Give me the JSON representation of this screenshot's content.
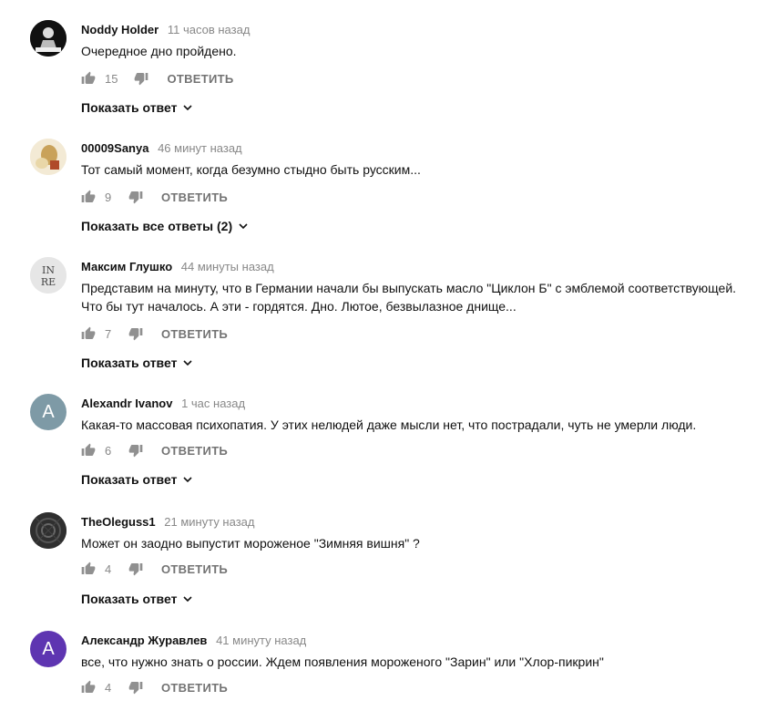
{
  "comments": [
    {
      "author": "Noddy Holder",
      "time": "11 часов назад",
      "text": "Очередное дно пройдено.",
      "likes": "15",
      "reply_label": "ОТВЕТИТЬ",
      "show_replies": "Показать ответ",
      "avatar_letter": "",
      "avatar_color": "#111111"
    },
    {
      "author": "00009Sanya",
      "time": "46 минут назад",
      "text": "Тот самый момент, когда безумно стыдно быть русским...",
      "likes": "9",
      "reply_label": "ОТВЕТИТЬ",
      "show_replies": "Показать все ответы (2)",
      "avatar_letter": "",
      "avatar_color": "#c9a25a"
    },
    {
      "author": "Максим Глушко",
      "time": "44 минуты назад",
      "text": "Представим на минуту, что в Германии начали бы выпускать масло \"Циклон Б\" с эмблемой соответствующей. Что бы тут началось. А эти - гордятся. Дно. Лютое, безвылазное днище...",
      "likes": "7",
      "reply_label": "ОТВЕТИТЬ",
      "show_replies": "Показать ответ",
      "avatar_letter": "IN RE",
      "avatar_color": "#dddddd"
    },
    {
      "author": "Alexandr Ivanov",
      "time": "1 час назад",
      "text": "Какая-то массовая психопатия. У этих нелюдей даже мысли нет, что пострадали, чуть не умерли люди.",
      "likes": "6",
      "reply_label": "ОТВЕТИТЬ",
      "show_replies": "Показать ответ",
      "avatar_letter": "A",
      "avatar_color": "#7e9aa6"
    },
    {
      "author": "TheOleguss1",
      "time": "21 минуту назад",
      "text": "Может он заодно выпустит мороженое \"Зимняя вишня\" ?",
      "likes": "4",
      "reply_label": "ОТВЕТИТЬ",
      "show_replies": "Показать ответ",
      "avatar_letter": "",
      "avatar_color": "#3a3a3a"
    },
    {
      "author": "Александр Журавлев",
      "time": "41 минуту назад",
      "text": "все, что нужно знать о россии. Ждем появления мороженого \"Зарин\" или \"Хлор-пикрин\"",
      "likes": "4",
      "reply_label": "ОТВЕТИТЬ",
      "show_replies": "",
      "avatar_letter": "A",
      "avatar_color": "#5e35b1"
    }
  ]
}
